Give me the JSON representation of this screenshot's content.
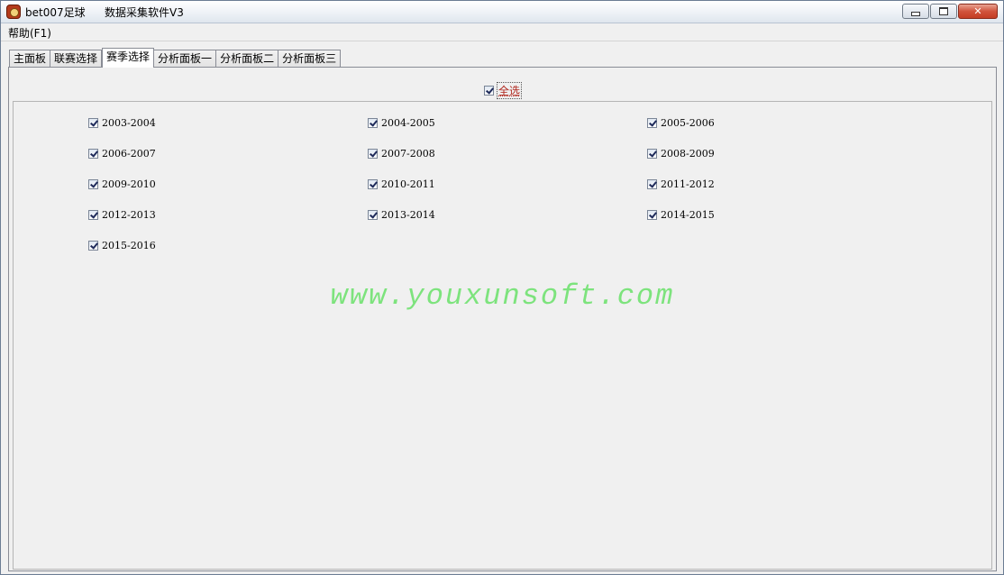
{
  "window": {
    "title": "bet007足球",
    "subtitle": "数据采集软件V3",
    "icon": "app-ball-icon"
  },
  "menu": {
    "help": "帮助(F1)"
  },
  "tabs": [
    {
      "label": "主面板"
    },
    {
      "label": "联赛选择"
    },
    {
      "label": "赛季选择"
    },
    {
      "label": "分析面板一"
    },
    {
      "label": "分析面板二"
    },
    {
      "label": "分析面板三"
    }
  ],
  "select_all": {
    "label": "全选",
    "checked": true
  },
  "seasons": [
    {
      "label": "2003-2004",
      "checked": true
    },
    {
      "label": "2004-2005",
      "checked": true
    },
    {
      "label": "2005-2006",
      "checked": true
    },
    {
      "label": "2006-2007",
      "checked": true
    },
    {
      "label": "2007-2008",
      "checked": true
    },
    {
      "label": "2008-2009",
      "checked": true
    },
    {
      "label": "2009-2010",
      "checked": true
    },
    {
      "label": "2010-2011",
      "checked": true
    },
    {
      "label": "2011-2012",
      "checked": true
    },
    {
      "label": "2012-2013",
      "checked": true
    },
    {
      "label": "2013-2014",
      "checked": true
    },
    {
      "label": "2014-2015",
      "checked": true
    },
    {
      "label": "2015-2016",
      "checked": true
    }
  ],
  "watermark": "www.youxunsoft.com",
  "colors": {
    "watermark": "#7de37d",
    "select_all_text": "#b0281e"
  }
}
